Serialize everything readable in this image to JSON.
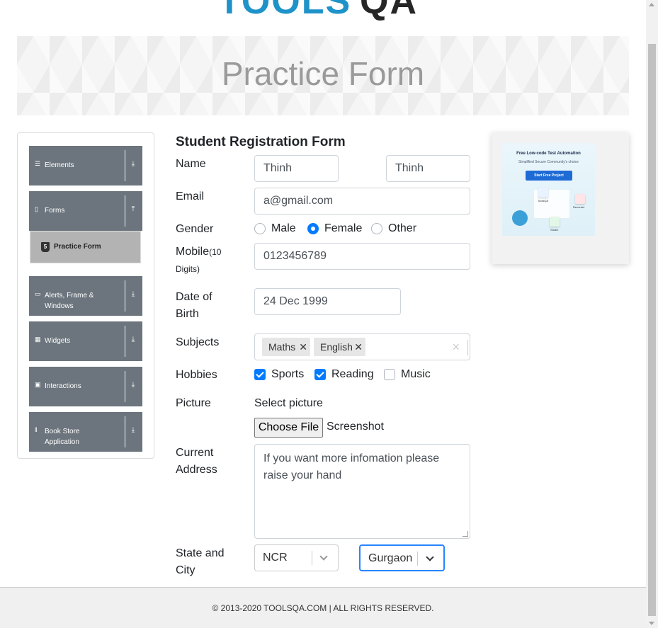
{
  "header": {
    "logo_tools": "TOOLS",
    "logo_qa": "QA",
    "banner_title": "Practice Form"
  },
  "sidebar": {
    "groups": [
      {
        "label": "Elements",
        "icon": "hamburger-icon",
        "toggle": "download-arrow-icon"
      },
      {
        "label": "Forms",
        "icon": "document-icon",
        "toggle": "upload-arrow-icon"
      },
      {
        "label": "Alerts, Frame & Windows",
        "icon": "window-icon",
        "toggle": "download-arrow-icon"
      },
      {
        "label": "Widgets",
        "icon": "grid-icon",
        "toggle": "download-arrow-icon"
      },
      {
        "label": "Interactions",
        "icon": "interaction-icon",
        "toggle": "download-arrow-icon"
      },
      {
        "label": "Book Store Application",
        "icon": "books-icon",
        "toggle": "download-arrow-icon"
      }
    ],
    "active_subitem": {
      "label": "Practice Form",
      "icon": "html5-icon"
    }
  },
  "form": {
    "title": "Student Registration Form",
    "name_label": "Name",
    "first_name": "Thinh",
    "last_name": "Thinh",
    "email_label": "Email",
    "email": "a@gmail.com",
    "gender_label": "Gender",
    "gender_options": [
      "Male",
      "Female",
      "Other"
    ],
    "gender_selected": "Female",
    "mobile_label": "Mobile",
    "mobile_hint": "(10 Digits)",
    "mobile": "0123456789",
    "dob_label": "Date of Birth",
    "dob": "24 Dec 1999",
    "subjects_label": "Subjects",
    "subjects": [
      "Maths",
      "English"
    ],
    "hobbies_label": "Hobbies",
    "hobbies": [
      {
        "label": "Sports",
        "checked": true
      },
      {
        "label": "Reading",
        "checked": true
      },
      {
        "label": "Music",
        "checked": false
      }
    ],
    "picture_label": "Picture",
    "select_picture": "Select picture",
    "choose_file": "Choose File",
    "file_name": "Screenshot",
    "address_label": "Current Address",
    "address": "If you want more infomation please raise your hand",
    "state_city_label": "State and City",
    "state": "NCR",
    "city": "Gurgaon"
  },
  "ad": {
    "headline": "Free Low-code Test Automation",
    "subline": "Simplified Secure Community's choice",
    "cta": "Start Free Project",
    "tiles": [
      "ToolsQA",
      "Recorder",
      "Studio"
    ]
  },
  "footer": {
    "text": "© 2013-2020 TOOLSQA.COM | ALL RIGHTS RESERVED."
  },
  "colors": {
    "accent": "#007bff",
    "sidebar_group": "#6c757d",
    "active_item": "#b3b3b3",
    "focus_border": "#2684ff",
    "logo_blue": "#1e93c9"
  }
}
